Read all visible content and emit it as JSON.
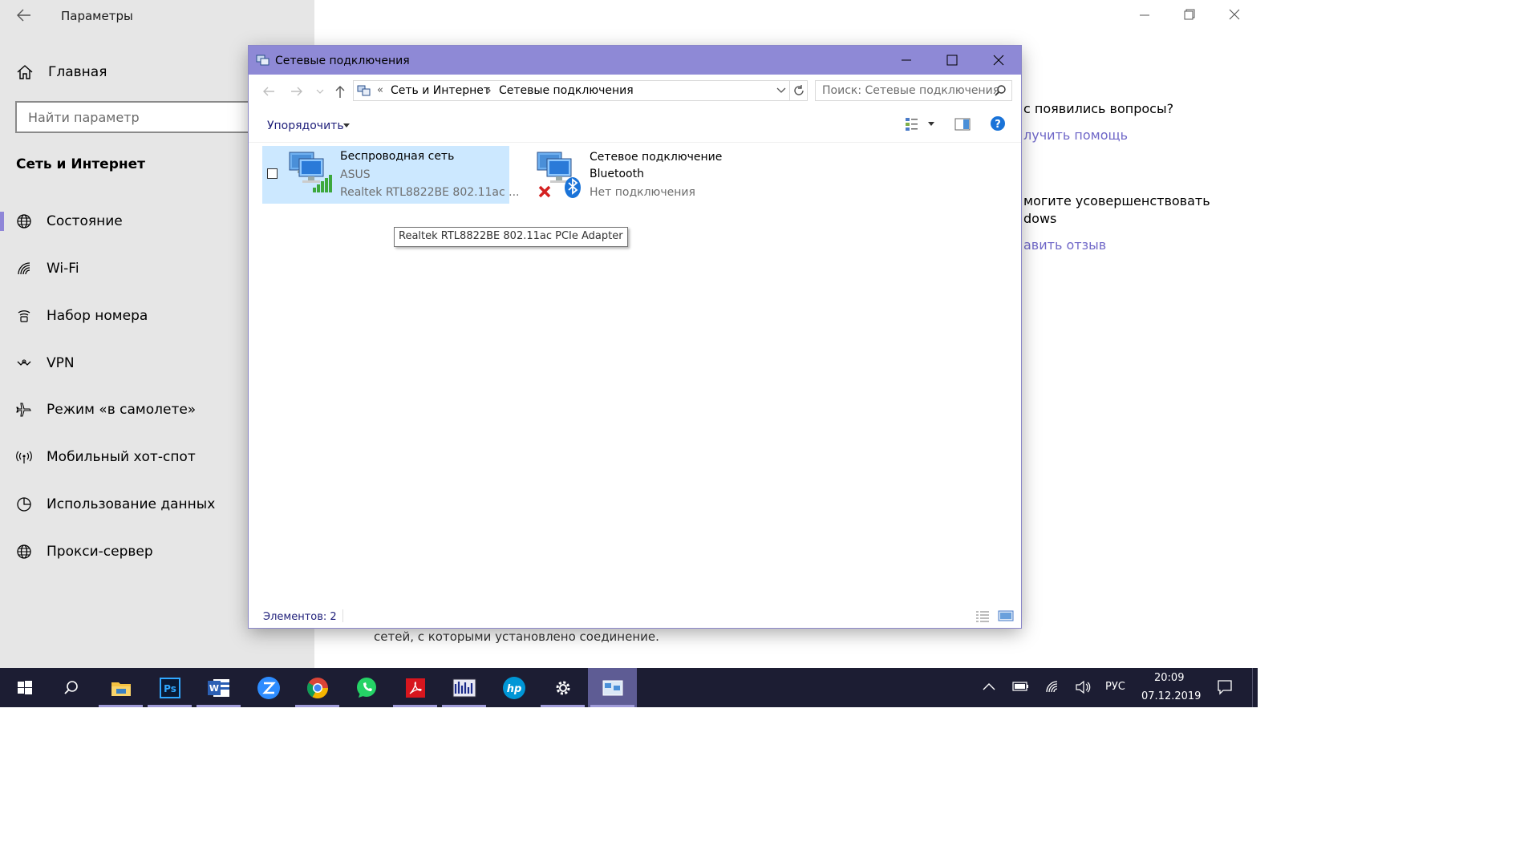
{
  "settings": {
    "title": "Параметры",
    "home_label": "Главная",
    "search_placeholder": "Найти параметр",
    "section_title": "Сеть и Интернет",
    "nav": [
      {
        "label": "Состояние",
        "icon": "globe-icon"
      },
      {
        "label": "Wi-Fi",
        "icon": "wifi-icon"
      },
      {
        "label": "Набор номера",
        "icon": "dialup-icon"
      },
      {
        "label": "VPN",
        "icon": "vpn-icon"
      },
      {
        "label": "Режим «в самолете»",
        "icon": "airplane-icon"
      },
      {
        "label": "Мобильный хот-спот",
        "icon": "hotspot-icon"
      },
      {
        "label": "Использование данных",
        "icon": "data-usage-icon"
      },
      {
        "label": "Прокси-сервер",
        "icon": "globe-icon"
      }
    ],
    "active_nav": "Состояние",
    "right_panel": {
      "question_text": "с появились вопросы?",
      "help_link": "лучить помощь",
      "improve_line1": "могите усовершенствовать",
      "improve_line2": "dows",
      "feedback_link": "авить отзыв",
      "bottom_text": "сетей, с которыми установлено соединение."
    }
  },
  "explorer": {
    "title": "Сетевые подключения",
    "breadcrumb": {
      "chevron": "«",
      "items": [
        "Сеть и Интернет",
        "Сетевые подключения"
      ]
    },
    "search_placeholder": "Поиск: Сетевые подключения",
    "organize_label": "Упорядочить",
    "connections": [
      {
        "name": "Беспроводная сеть",
        "network": "ASUS",
        "adapter": "Realtek RTL8822BE 802.11ac ...",
        "selected": true
      },
      {
        "name": "Сетевое подключение",
        "name2": "Bluetooth",
        "status": "Нет подключения"
      }
    ],
    "tooltip": "Realtek RTL8822BE 802.11ac PCIe Adapter",
    "status_bar": "Элементов: 2"
  },
  "taskbar": {
    "apps": [
      "start-icon",
      "search-icon",
      "file-explorer-icon",
      "photoshop-icon",
      "word-icon",
      "zoom-icon",
      "chrome-icon",
      "whatsapp-icon",
      "acrobat-icon",
      "app-icon",
      "hp-icon",
      "settings-icon",
      "network-connections-icon"
    ],
    "lang": "РУС",
    "time": "20:09",
    "date": "07.12.2019"
  },
  "colors": {
    "accent": "#8e89d6",
    "link": "#7068c8",
    "taskbar": "#1c1d33",
    "selection": "#cce8ff"
  }
}
